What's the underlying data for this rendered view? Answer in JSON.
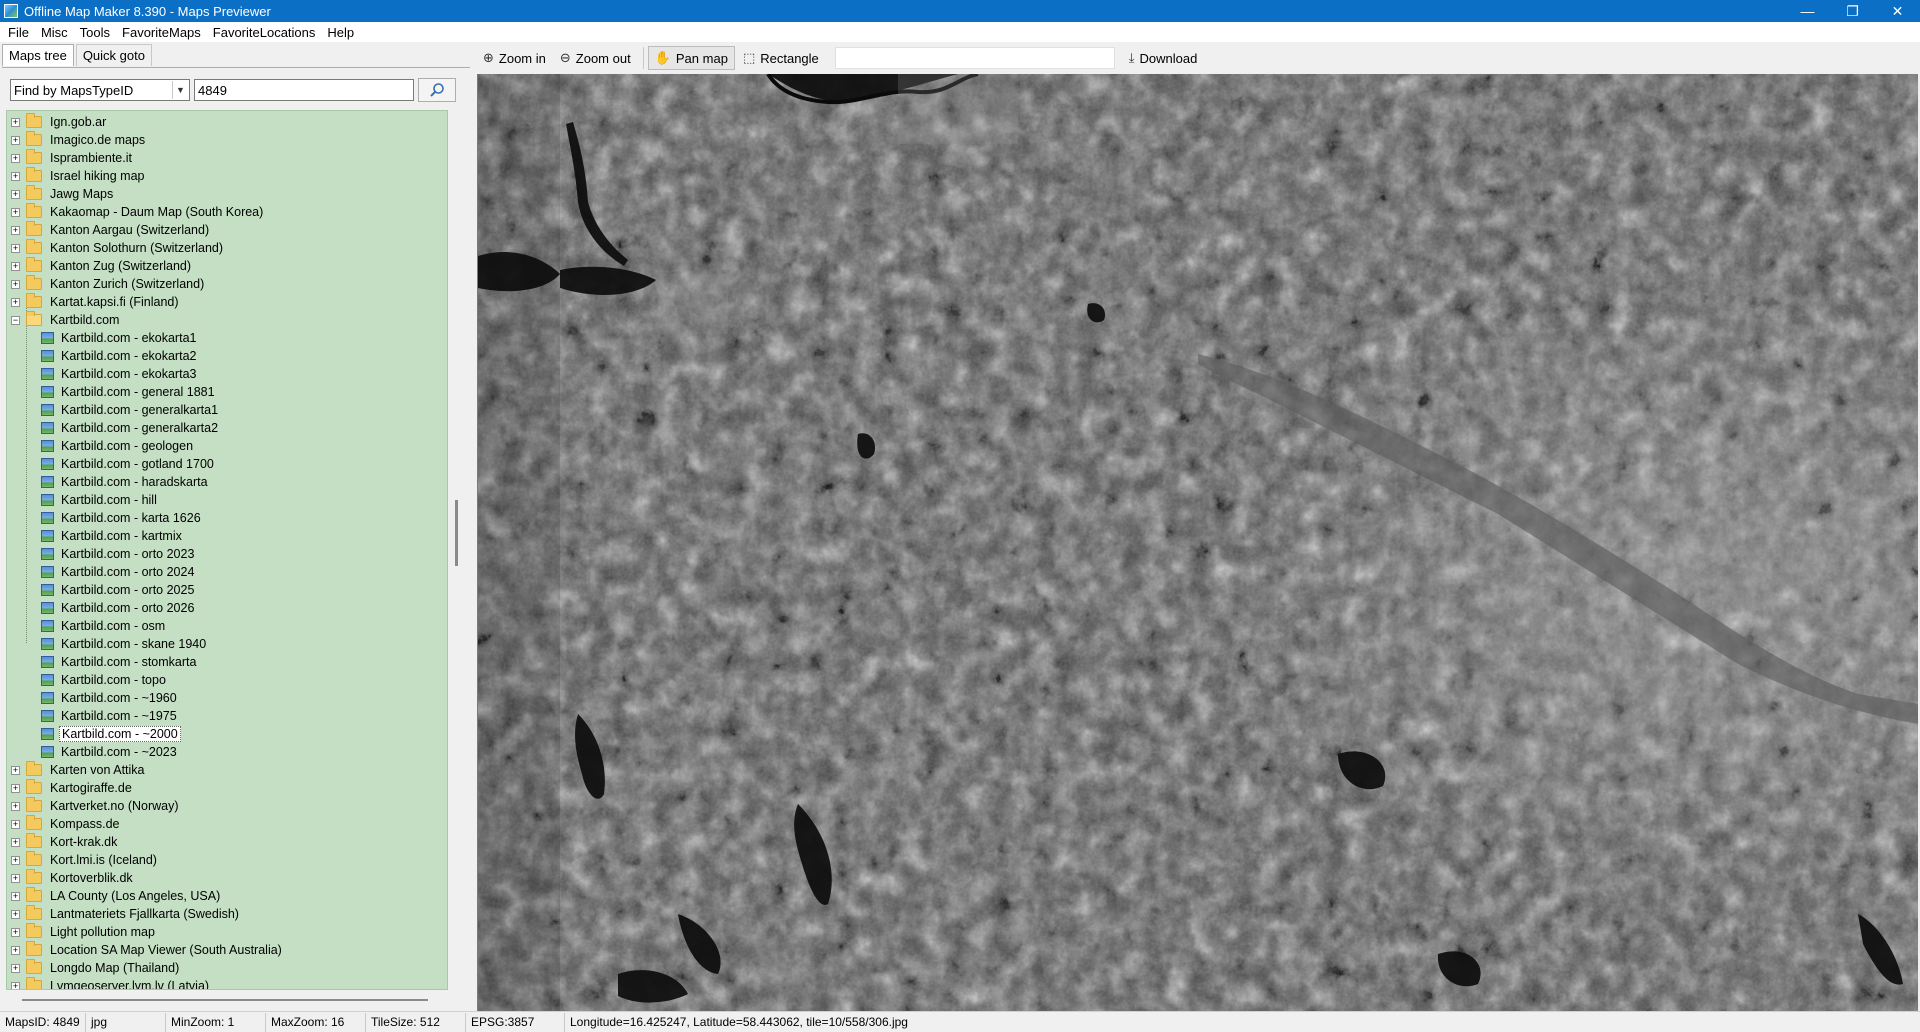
{
  "window": {
    "title": "Offline Map Maker 8.390 - Maps Previewer",
    "controls": [
      "—",
      "❐",
      "✕"
    ]
  },
  "menu": [
    "File",
    "Misc",
    "Tools",
    "FavoriteMaps",
    "FavoriteLocations",
    "Help"
  ],
  "left_panel": {
    "tabs": [
      "Maps tree",
      "Quick goto"
    ],
    "find_by": "Find by MapsTypeID",
    "find_value": "4849",
    "tree": {
      "top_groups": [
        "Ign.gob.ar",
        "Imagico.de maps",
        "Isprambiente.it",
        "Israel hiking map",
        "Jawg Maps",
        "Kakaomap - Daum Map (South Korea)",
        "Kanton Aargau (Switzerland)",
        "Kanton Solothurn (Switzerland)",
        "Kanton Zug (Switzerland)",
        "Kanton Zurich (Switzerland)",
        "Kartat.kapsi.fi (Finland)"
      ],
      "expanded_group": "Kartbild.com",
      "children": [
        "Kartbild.com - ekokarta1",
        "Kartbild.com - ekokarta2",
        "Kartbild.com - ekokarta3",
        "Kartbild.com - general 1881",
        "Kartbild.com - generalkarta1",
        "Kartbild.com - generalkarta2",
        "Kartbild.com - geologen",
        "Kartbild.com - gotland 1700",
        "Kartbild.com - haradskarta",
        "Kartbild.com - hill",
        "Kartbild.com - karta 1626",
        "Kartbild.com - kartmix",
        "Kartbild.com - orto 2023",
        "Kartbild.com - orto 2024",
        "Kartbild.com - orto 2025",
        "Kartbild.com - orto 2026",
        "Kartbild.com - osm",
        "Kartbild.com - skane 1940",
        "Kartbild.com - stomkarta",
        "Kartbild.com - topo",
        "Kartbild.com - ~1960",
        "Kartbild.com - ~1975",
        "Kartbild.com - ~2000",
        "Kartbild.com - ~2023"
      ],
      "selected": "Kartbild.com - ~2000",
      "bottom_groups": [
        "Karten von Attika",
        "Kartogiraffe.de",
        "Kartverket.no (Norway)",
        "Kompass.de",
        "Kort-krak.dk",
        "Kort.lmi.is (Iceland)",
        "Kortoverblik.dk",
        "LA County (Los Angeles, USA)",
        "Lantmateriets Fjallkarta (Swedish)",
        "Light pollution map",
        "Location SA Map Viewer (South Australia)",
        "Longdo Map (Thailand)",
        "Lvmgeoserver.lvm.lv (Latvia)"
      ]
    }
  },
  "toolbar": {
    "zoom_in": "Zoom in",
    "zoom_out": "Zoom out",
    "pan_map": "Pan map",
    "rectangle": "Rectangle",
    "download": "Download"
  },
  "statusbar": {
    "maps_id": "MapsID: 4849",
    "format": "jpg",
    "min_zoom": "MinZoom: 1",
    "max_zoom": "MaxZoom: 16",
    "tile_size": "TileSize: 512",
    "epsg": "EPSG:3857",
    "position": "Longitude=16.425247, Latitude=58.443062, tile=10/558/306.jpg"
  }
}
